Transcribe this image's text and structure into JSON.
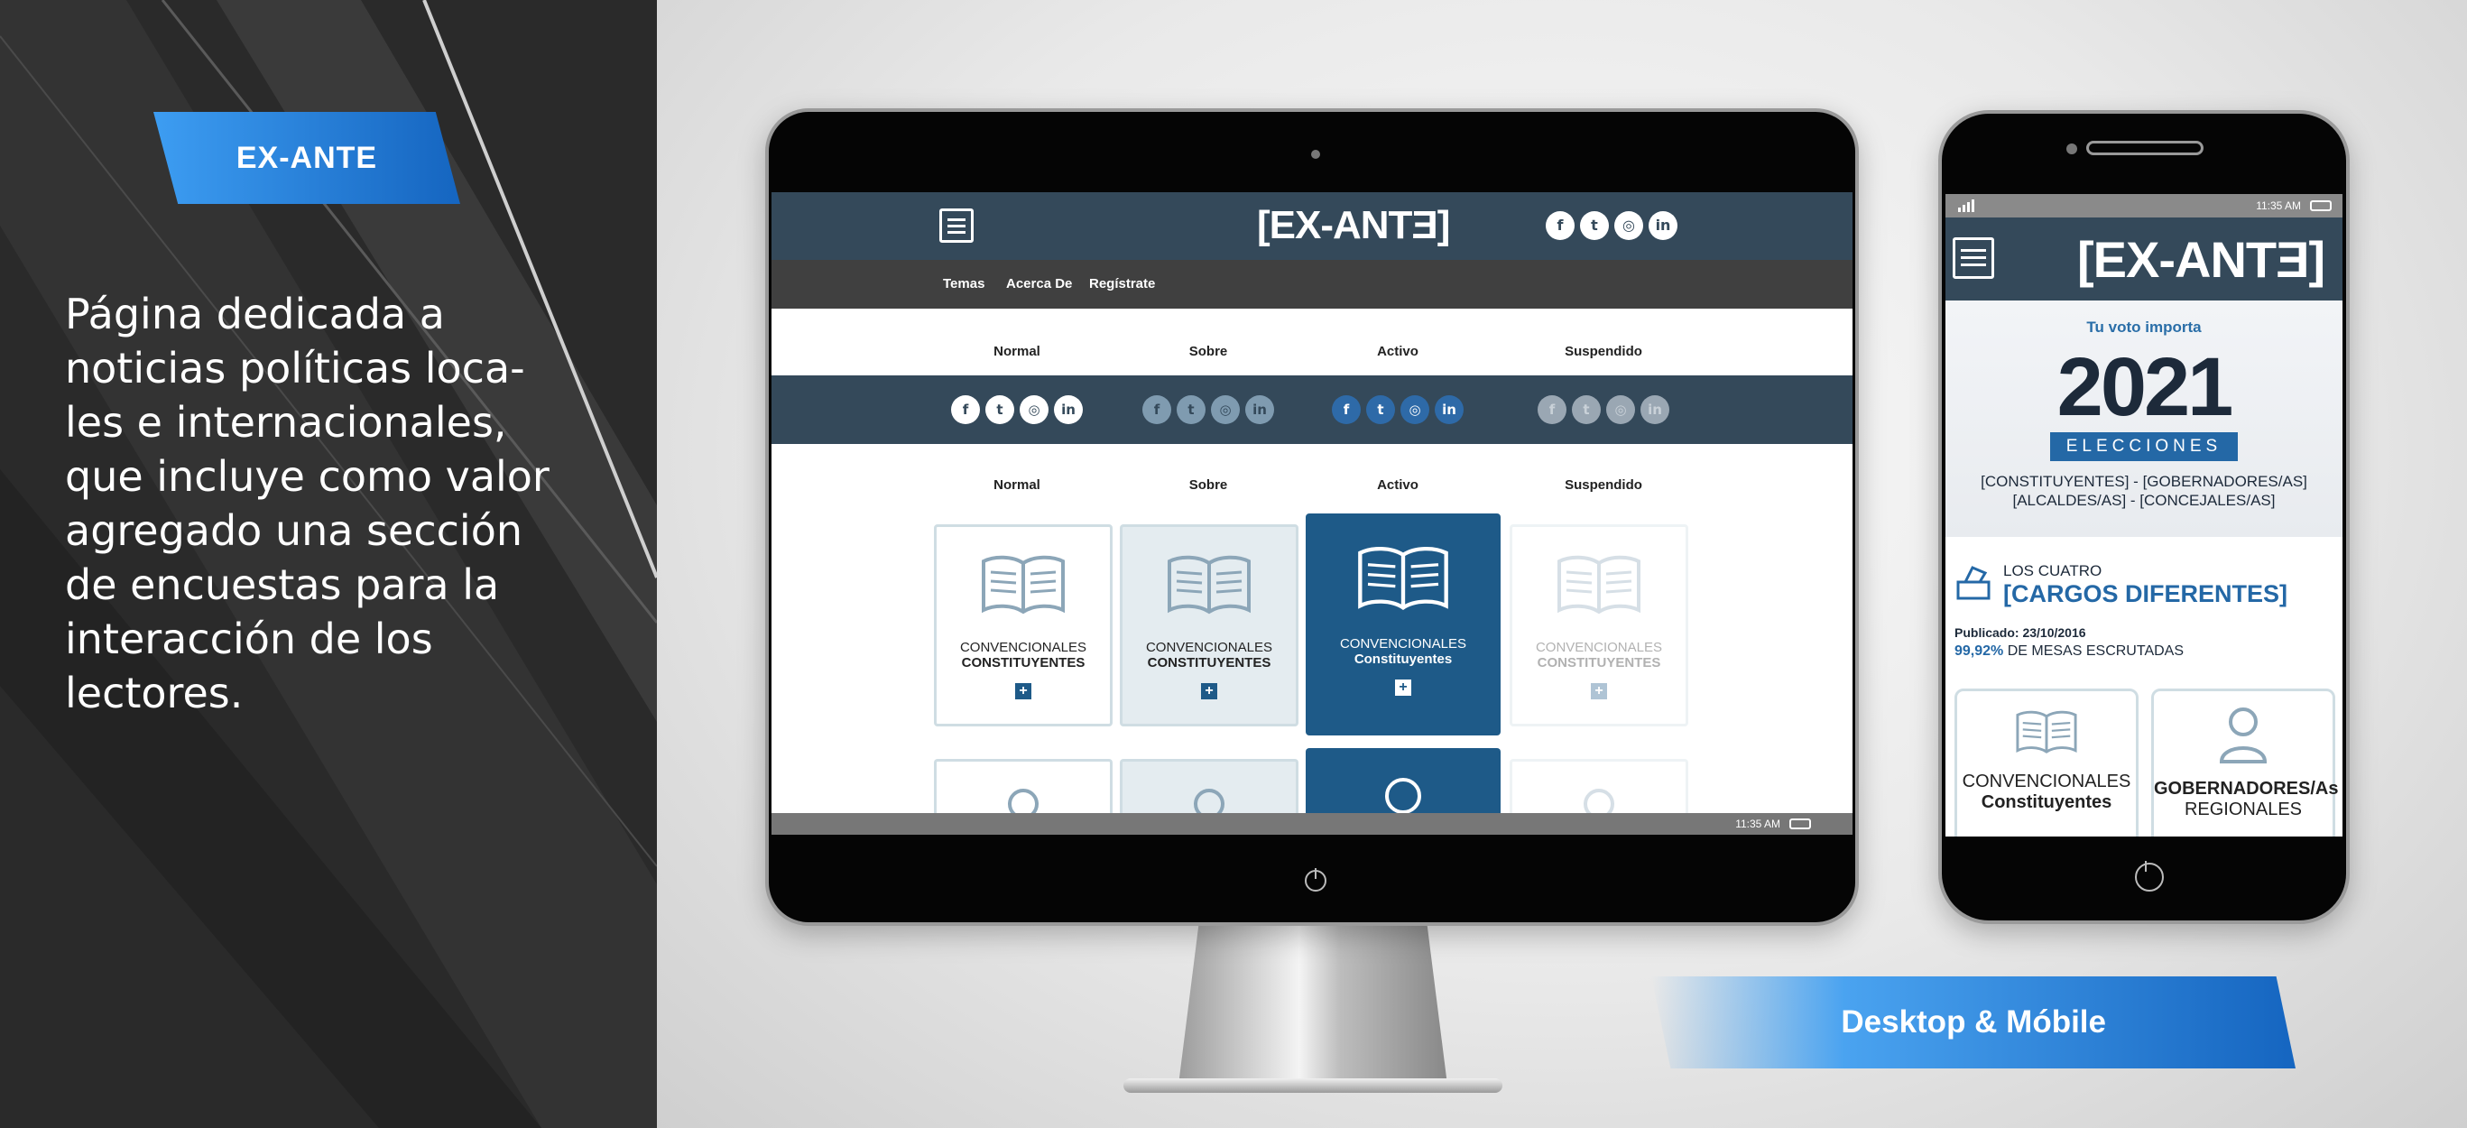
{
  "tag_label": "EX-ANTE",
  "description": "Página dedicada a\nnoticias políticas loca-\nles e internacionales,\nque incluye como valor\nagregado una sección\nde encuestas para la\ninteracción de los\nlectores.",
  "bottom_label": "Desktop & Móbile",
  "desktop": {
    "logo": "[EX-ANTƎ]",
    "nav": [
      "Temas",
      "Acerca De",
      "Regístrate"
    ],
    "state_labels": [
      "Normal",
      "Sobre",
      "Activo",
      "Suspendido"
    ],
    "card_line1": "CONVENCIONALES",
    "card_line2": "CONSTITUYENTES",
    "card_line2_active": "Constituyentes",
    "status_time": "11:35 AM"
  },
  "mobile": {
    "logo": "[EX-ANTƎ]",
    "status_time": "11:35 AM",
    "hero_small": "Tu voto importa",
    "hero_year": "2021",
    "hero_box": "ELECCIONES",
    "hero_cargos": "[CONSTITUYENTES] - [GOBERNADORES/AS]\n[ALCALDES/AS] - [CONCEJALES/AS]",
    "sub": "LOS CUATRO",
    "big": "[CARGOS DIFERENTES]",
    "published": "Publicado: 23/10/2016",
    "pct_value": "99,92%",
    "pct_text": " DE MESAS ESCRUTADAS",
    "card1_line1": "CONVENCIONALES",
    "card1_line2": "Constituyentes",
    "card2_line1": "GOBERNADORES/As",
    "card2_line2": "REGIONALES"
  },
  "icons": [
    "facebook-icon",
    "twitter-icon",
    "instagram-icon",
    "linkedin-icon",
    "book-icon",
    "user-icon",
    "ballot-box-icon",
    "menu-icon",
    "power-icon"
  ],
  "colors": {
    "accent": "#1e5a88",
    "header": "#34495a",
    "tag": "#1565c0"
  }
}
